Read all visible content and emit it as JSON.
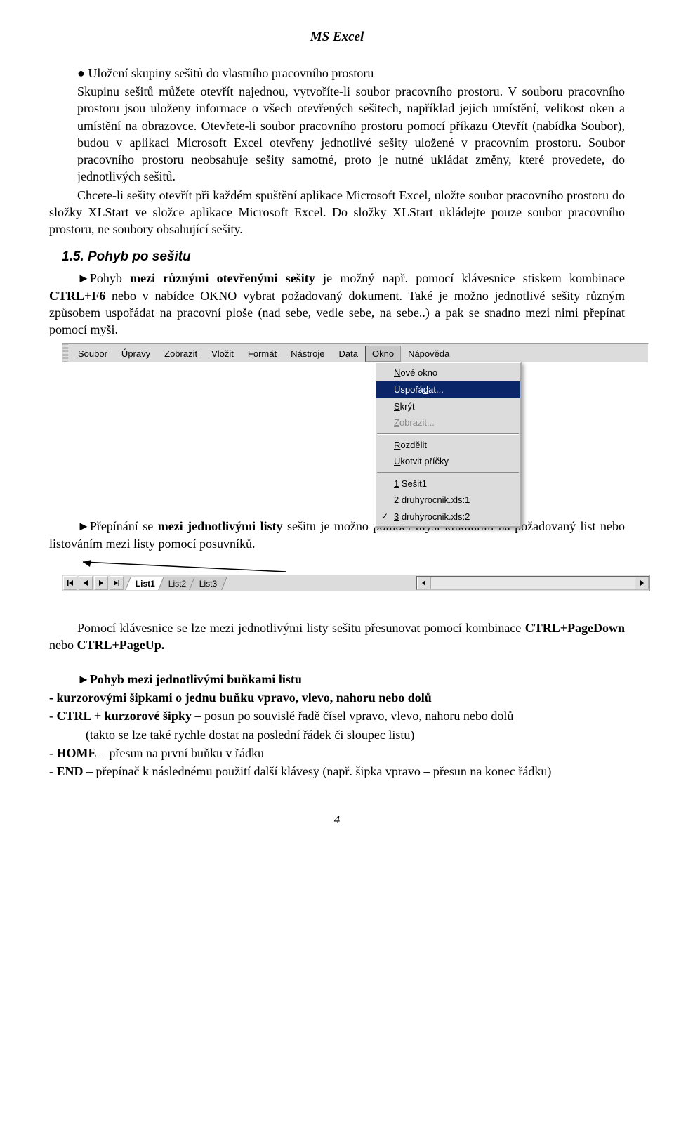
{
  "header": "MS Excel",
  "bullet": "● Uložení skupiny sešitů do vlastního pracovního prostoru",
  "para1": "Skupinu sešitů můžete otevřít najednou, vytvoříte-li soubor pracovního prostoru. V souboru pracovního prostoru jsou uloženy informace o všech otevřených sešitech, například jejich umístění, velikost oken a umístění na obrazovce. Otevřete-li soubor pracovního prostoru pomocí příkazu Otevřít (nabídka Soubor), budou v aplikaci Microsoft Excel otevřeny jednotlivé sešity uložené v pracovním prostoru. Soubor pracovního prostoru neobsahuje sešity samotné, proto je nutné ukládat změny, které provedete, do jednotlivých sešitů.",
  "para2": "Chcete-li sešity otevřít při každém spuštění aplikace Microsoft Excel, uložte soubor pracovního prostoru do složky XLStart ve složce aplikace Microsoft Excel. Do složky XLStart ukládejte pouze soubor pracovního prostoru, ne soubory obsahující sešity.",
  "section": "1.5. Pohyb po sešitu",
  "para3a": "►Pohyb ",
  "para3b": "mezi různými otevřenými sešity",
  "para3c": " je možný např. pomocí klávesnice stiskem kombinace ",
  "para3d": "CTRL+F6",
  "para3e": " nebo v nabídce OKNO vybrat požadovaný dokument. Také je možno jednotlivé sešity různým způsobem uspořádat na pracovní ploše (nad sebe, vedle sebe, na sebe..) a pak se snadno mezi nimi přepínat pomocí myši.",
  "menu": {
    "items": [
      "Soubor",
      "Úpravy",
      "Zobrazit",
      "Vložit",
      "Formát",
      "Nástroje",
      "Data",
      "Okno",
      "Nápověda"
    ],
    "active": "Okno",
    "dropdown": [
      {
        "label": "Nové okno",
        "ul": "N"
      },
      {
        "label": "Uspořádat...",
        "ul": "d",
        "selected": true
      },
      {
        "label": "Skrýt",
        "ul": "S"
      },
      {
        "label": "Zobrazit...",
        "ul": "Z",
        "disabled": true
      },
      {
        "sep": true
      },
      {
        "label": "Rozdělit",
        "ul": "R"
      },
      {
        "label": "Ukotvit příčky",
        "ul": "U"
      },
      {
        "sep": true
      },
      {
        "label": "1 Sešit1",
        "ul": "1"
      },
      {
        "label": "2 druhyrocnik.xls:1",
        "ul": "2"
      },
      {
        "label": "3 druhyrocnik.xls:2",
        "ul": "3",
        "checked": true
      }
    ]
  },
  "para4a": "►Přepínání se ",
  "para4b": "mezi jednotlivými listy",
  "para4c": " sešitu je možno pomocí myši kliknutím na požadovaný list nebo listováním mezi listy pomocí posuvníků.",
  "tabs": [
    "List1",
    "List2",
    "List3"
  ],
  "para5a": "Pomocí klávesnice se lze mezi jednotlivými listy sešitu přesunovat pomocí kombinace ",
  "para5b": "CTRL+PageDown",
  "para5c": " nebo ",
  "para5d": "CTRL+PageUp.",
  "para6": "►Pohyb mezi jednotlivými buňkami listu",
  "l1": "- kurzorovými šipkami o jednu buňku vpravo, vlevo, nahoru nebo dolů",
  "l2p": "- ",
  "l2a": "CTRL + kurzorové šipky",
  "l2b": " – posun po souvislé řadě čísel vpravo, vlevo, nahoru nebo dolů",
  "l2c": "(takto se lze také rychle dostat na poslední řádek či sloupec listu)",
  "l3p": "- ",
  "l3a": "HOME",
  "l3b": " – přesun na první buňku v řádku",
  "l4p": "- ",
  "l4a": "END",
  "l4b": " – přepínač k následnému použití další klávesy (např. šipka vpravo – přesun na konec řádku)",
  "pagenum": "4"
}
